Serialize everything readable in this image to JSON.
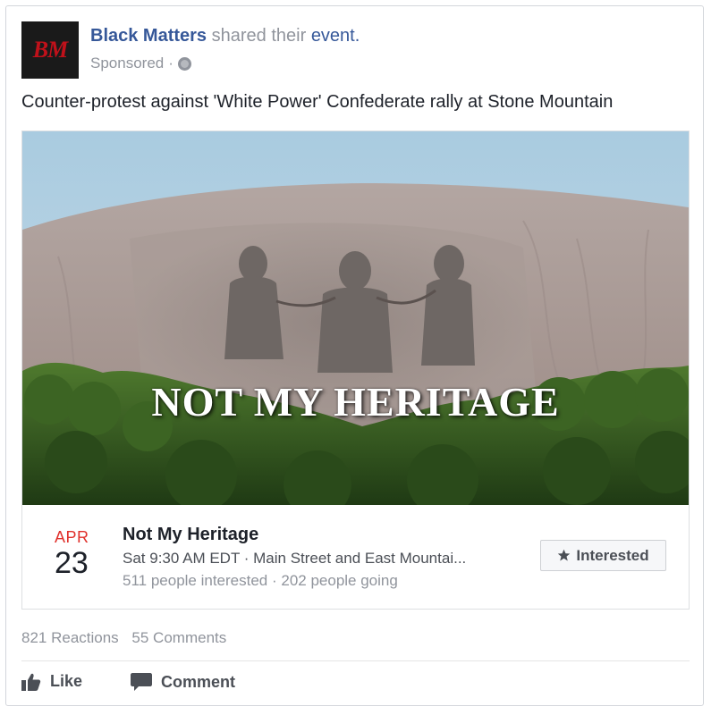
{
  "post": {
    "page_name": "Black Matters",
    "shared_text": "shared their",
    "event_link": "event.",
    "avatar_text": "BM",
    "sponsored": "Sponsored",
    "separator": "·",
    "globe_icon": "globe-icon",
    "text": "Counter-protest against 'White Power' Confederate rally at Stone Mountain"
  },
  "event": {
    "image_overlay_text": "NOT MY HERITAGE",
    "month": "APR",
    "day": "23",
    "title": "Not My Heritage",
    "time_location": "Sat 9:30 AM EDT · Main Street and East Mountai...",
    "stats": "511 people interested · 202 people going",
    "interested_icon": "star-icon",
    "interested_label": "Interested"
  },
  "engagement": {
    "reactions": "821 Reactions",
    "comments": "55 Comments"
  },
  "actions": {
    "like_label": "Like",
    "like_icon": "thumbs-up-icon",
    "comment_label": "Comment",
    "comment_icon": "speech-bubble-icon"
  },
  "colors": {
    "link_blue": "#365899",
    "date_red": "#e0302b",
    "meta_gray": "#90949c"
  }
}
